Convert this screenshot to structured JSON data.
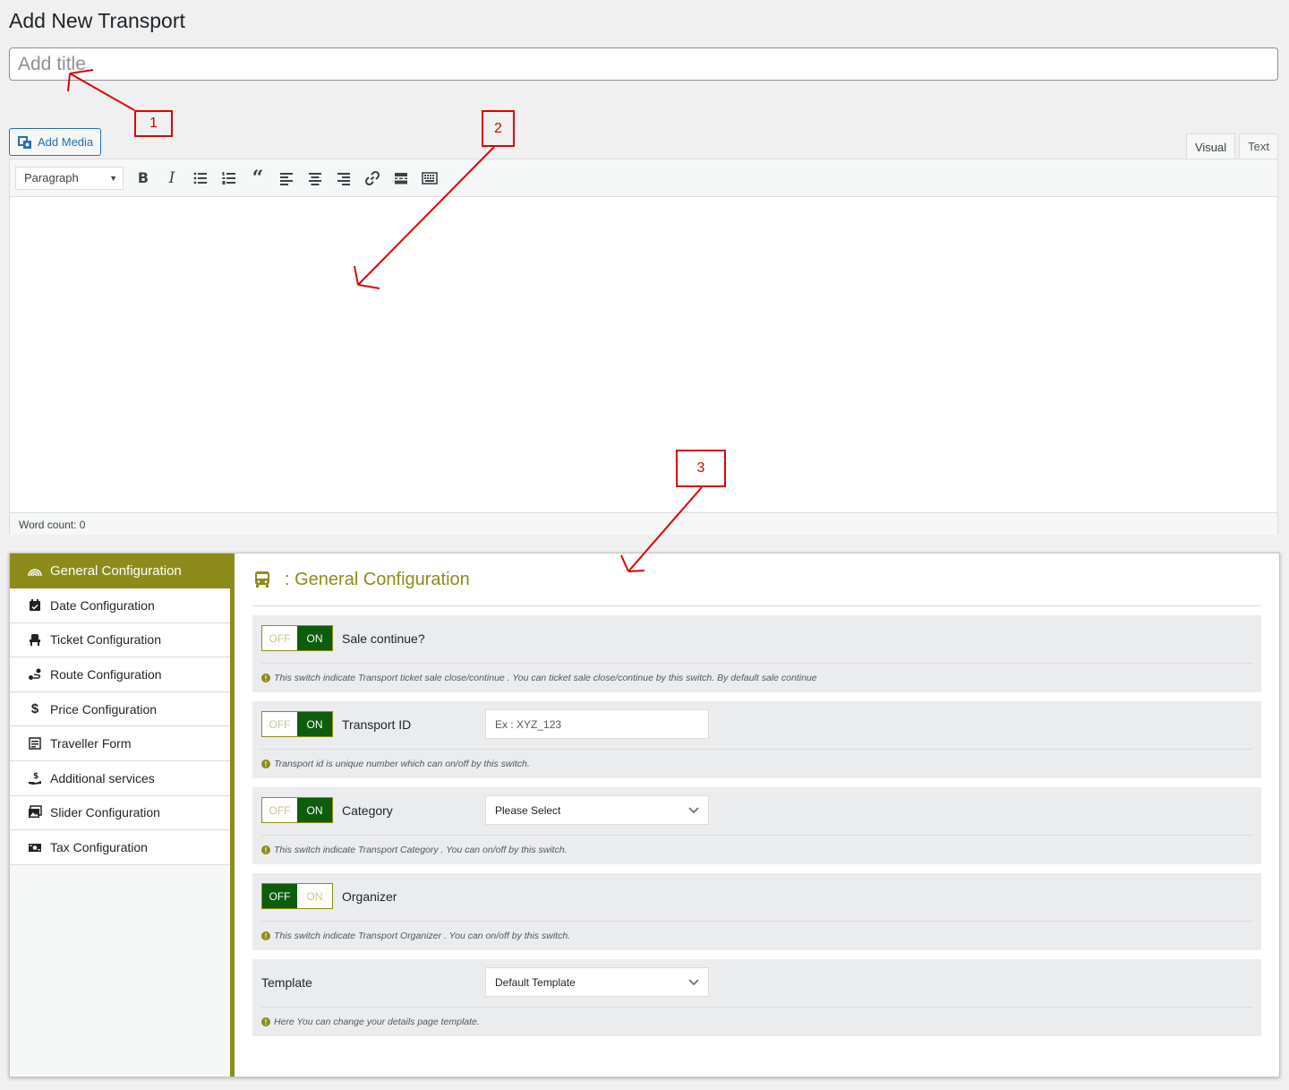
{
  "page": {
    "title": "Add New Transport"
  },
  "title_input": {
    "placeholder": "Add title"
  },
  "media": {
    "add_media_label": "Add Media"
  },
  "editor": {
    "tabs": [
      {
        "label": "Visual",
        "active": true
      },
      {
        "label": "Text",
        "active": false
      }
    ],
    "format_select": "Paragraph",
    "toolbar_icons": [
      "bold-icon",
      "italic-icon",
      "bullet-list-icon",
      "numbered-list-icon",
      "blockquote-icon",
      "align-left-icon",
      "align-center-icon",
      "align-right-icon",
      "link-icon",
      "read-more-icon",
      "toolbar-toggle-icon"
    ],
    "word_count": "Word count: 0"
  },
  "annotations": [
    "1",
    "2",
    "3"
  ],
  "sidebar": {
    "items": [
      {
        "label": "General Configuration",
        "icon": "rainbow-icon",
        "active": true
      },
      {
        "label": "Date Configuration",
        "icon": "calendar-icon"
      },
      {
        "label": "Ticket Configuration",
        "icon": "seat-icon"
      },
      {
        "label": "Route Configuration",
        "icon": "route-icon"
      },
      {
        "label": "Price Configuration",
        "icon": "dollar-icon"
      },
      {
        "label": "Traveller Form",
        "icon": "form-icon"
      },
      {
        "label": "Additional services",
        "icon": "hand-dollar-icon"
      },
      {
        "label": "Slider Configuration",
        "icon": "images-icon"
      },
      {
        "label": "Tax Configuration",
        "icon": "money-bill-icon"
      }
    ]
  },
  "content": {
    "title": ": General Configuration",
    "sections": [
      {
        "label": "Sale continue?",
        "switch": {
          "off": "OFF",
          "on": "ON",
          "state": "on"
        },
        "desc": "This switch indicate Transport ticket sale close/continue . You can ticket sale close/continue by this switch. By default sale continue"
      },
      {
        "label": "Transport ID",
        "switch": {
          "off": "OFF",
          "on": "ON",
          "state": "on"
        },
        "input_placeholder": "Ex : XYZ_123",
        "desc": "Transport id is unique number which can on/off by this switch."
      },
      {
        "label": "Category",
        "switch": {
          "off": "OFF",
          "on": "ON",
          "state": "on"
        },
        "select_value": "Please Select",
        "desc": "This switch indicate Transport Category . You can on/off by this switch."
      },
      {
        "label": "Organizer",
        "switch": {
          "off": "OFF",
          "on": "ON",
          "state": "off"
        },
        "desc": "This switch indicate Transport Organizer . You can on/off by this switch."
      },
      {
        "label": "Template",
        "select_value": "Default Template",
        "desc": "Here You can change your details page template."
      }
    ]
  },
  "colors": {
    "accent": "#8d8b1b",
    "switch_active": "#0e5c0e",
    "annotation": "#e00000",
    "link": "#2271b1"
  }
}
